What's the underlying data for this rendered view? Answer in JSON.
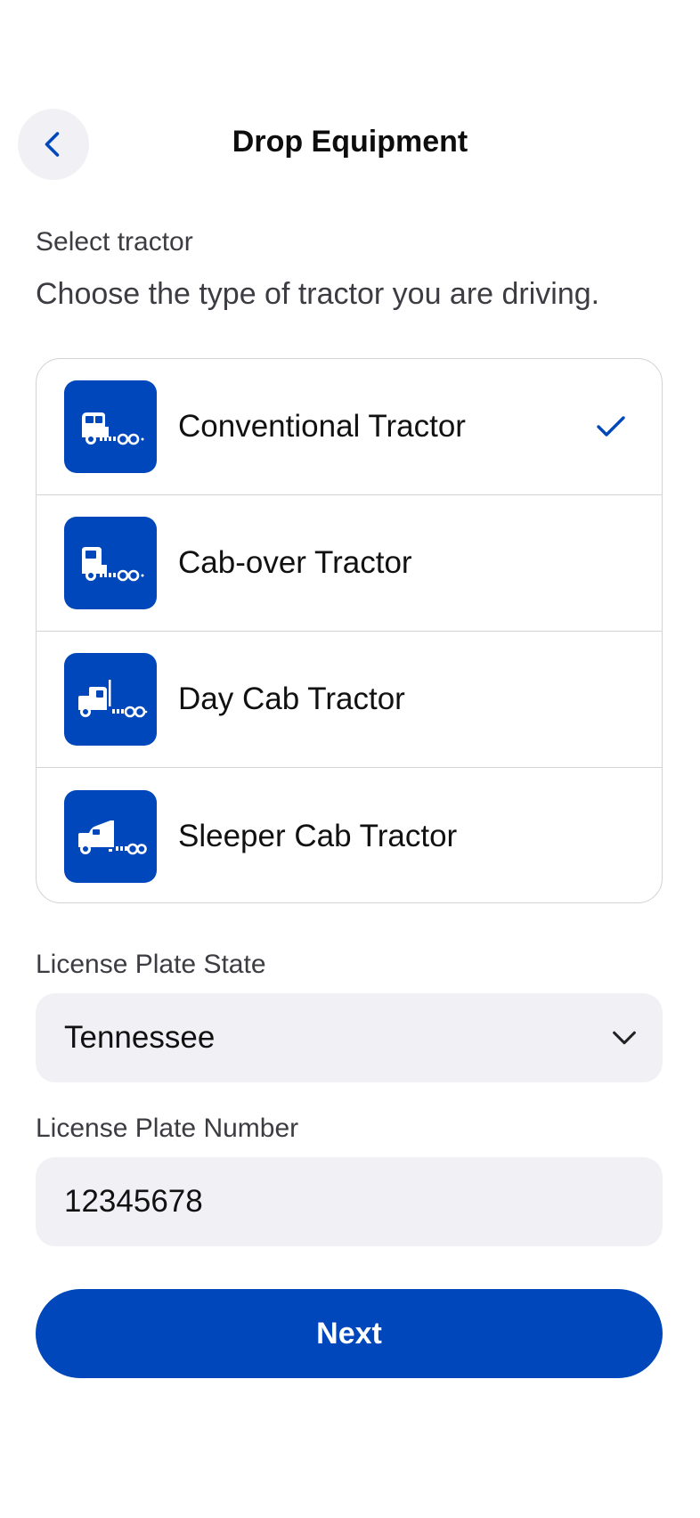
{
  "header": {
    "title": "Drop Equipment",
    "back_icon": "chevron-left-icon"
  },
  "tractor": {
    "label": "Select tractor",
    "description": "Choose the type of tractor you are driving.",
    "options": [
      {
        "label": "Conventional Tractor",
        "icon": "conventional-tractor-icon",
        "selected": true
      },
      {
        "label": "Cab-over Tractor",
        "icon": "cab-over-tractor-icon",
        "selected": false
      },
      {
        "label": "Day Cab Tractor",
        "icon": "day-cab-tractor-icon",
        "selected": false
      },
      {
        "label": "Sleeper Cab Tractor",
        "icon": "sleeper-cab-tractor-icon",
        "selected": false
      }
    ]
  },
  "plate_state": {
    "label": "License Plate State",
    "value": "Tennessee"
  },
  "plate_number": {
    "label": "License Plate Number",
    "value": "12345678"
  },
  "next_button": {
    "label": "Next"
  },
  "colors": {
    "accent": "#0047bb",
    "field_background": "#f1f1f5",
    "border": "#d2d2d7"
  }
}
